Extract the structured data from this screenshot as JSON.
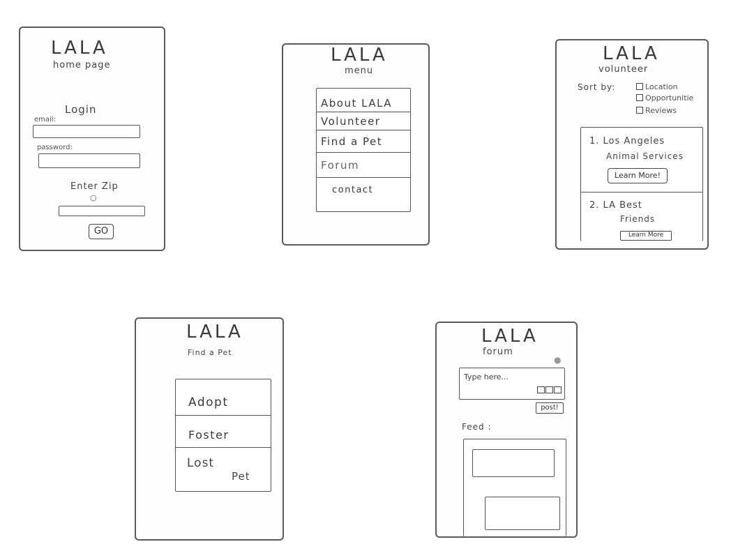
{
  "home": {
    "logo": "LALA",
    "subtitle": "home page",
    "login_title": "Login",
    "email_label": "email:",
    "password_label": "password:",
    "zip_label": "Enter Zip",
    "go_label": "GO"
  },
  "menu": {
    "logo": "LALA",
    "subtitle": "menu",
    "items": [
      "About LALA",
      "Volunteer",
      "Find a Pet",
      "Forum",
      "contact"
    ]
  },
  "volunteer": {
    "logo": "LALA",
    "subtitle": "volunteer",
    "sort_label": "Sort by:",
    "sort_options": [
      "Location",
      "Opportunitie",
      "Reviews"
    ],
    "results": [
      {
        "line1": "1. Los Angeles",
        "line2": "Animal Services",
        "button": "Learn More!"
      },
      {
        "line1": "2. LA Best",
        "line2": "Friends",
        "button": "Learn More"
      }
    ]
  },
  "findpet": {
    "logo": "LALA",
    "subtitle": "Find a Pet",
    "items": [
      "Adopt",
      "Foster",
      "Lost",
      "Pet"
    ]
  },
  "forum": {
    "logo": "LALA",
    "subtitle": "forum",
    "placeholder": "Type here...",
    "post_label": "post!",
    "feed_label": "Feed :"
  }
}
